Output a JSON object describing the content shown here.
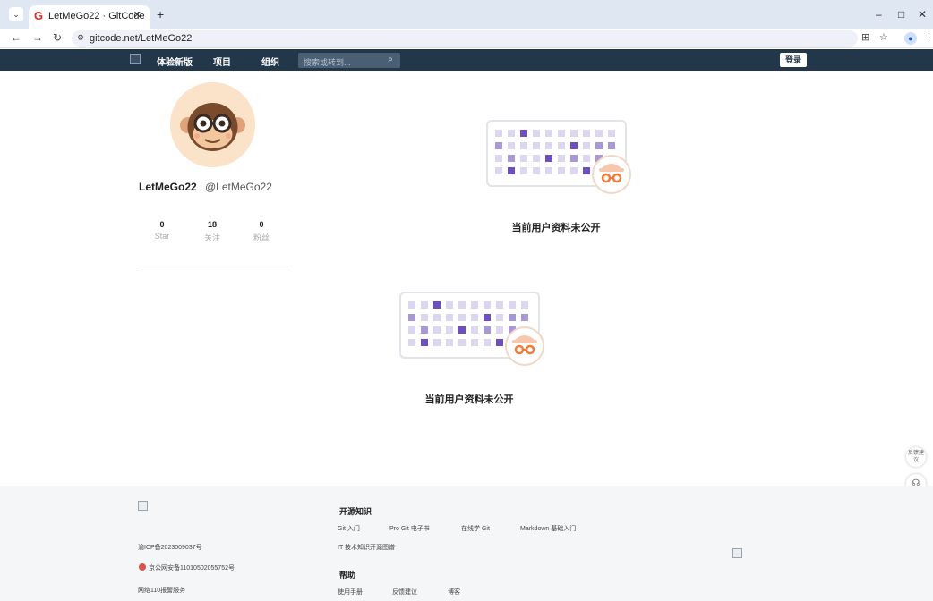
{
  "browser": {
    "tab_title": "LetMeGo22 · GitCode",
    "tab_favicon": "G",
    "tab_menu_icon": "chevron-down-icon",
    "new_tab": "+",
    "url": "gitcode.net/LetMeGo22",
    "window_controls": [
      "–",
      "□",
      "✕"
    ]
  },
  "header": {
    "nav": [
      "体验新版",
      "项目",
      "组织"
    ],
    "search_placeholder": "搜索或转到...",
    "login": "登录"
  },
  "profile": {
    "name": "LetMeGo22",
    "handle": "@LetMeGo22",
    "stats": [
      {
        "value": "0",
        "label": "Star"
      },
      {
        "value": "18",
        "label": "关注"
      },
      {
        "value": "0",
        "label": "粉丝"
      }
    ]
  },
  "private_notice": "当前用户资料未公开",
  "side_float": {
    "feedback": "反馈建议"
  },
  "footer": {
    "icp": "渝ICP备2023009037号",
    "police": "京公网安备11010502055752号",
    "report": "网络110报警服务",
    "sections": [
      {
        "title": "开源知识",
        "links": [
          "Git 入门",
          "Pro Git 电子书",
          "在线学 Git",
          "Markdown 基础入门",
          "IT 技术知识开源图谱"
        ]
      },
      {
        "title": "帮助",
        "links": [
          "使用手册",
          "反馈建议",
          "博客"
        ]
      }
    ]
  },
  "colors": {
    "header_bg": "#23374a",
    "accent_purple": "#6e4fc2",
    "light_purple": "#c8bde6",
    "badge_orange": "#f07a3a"
  }
}
